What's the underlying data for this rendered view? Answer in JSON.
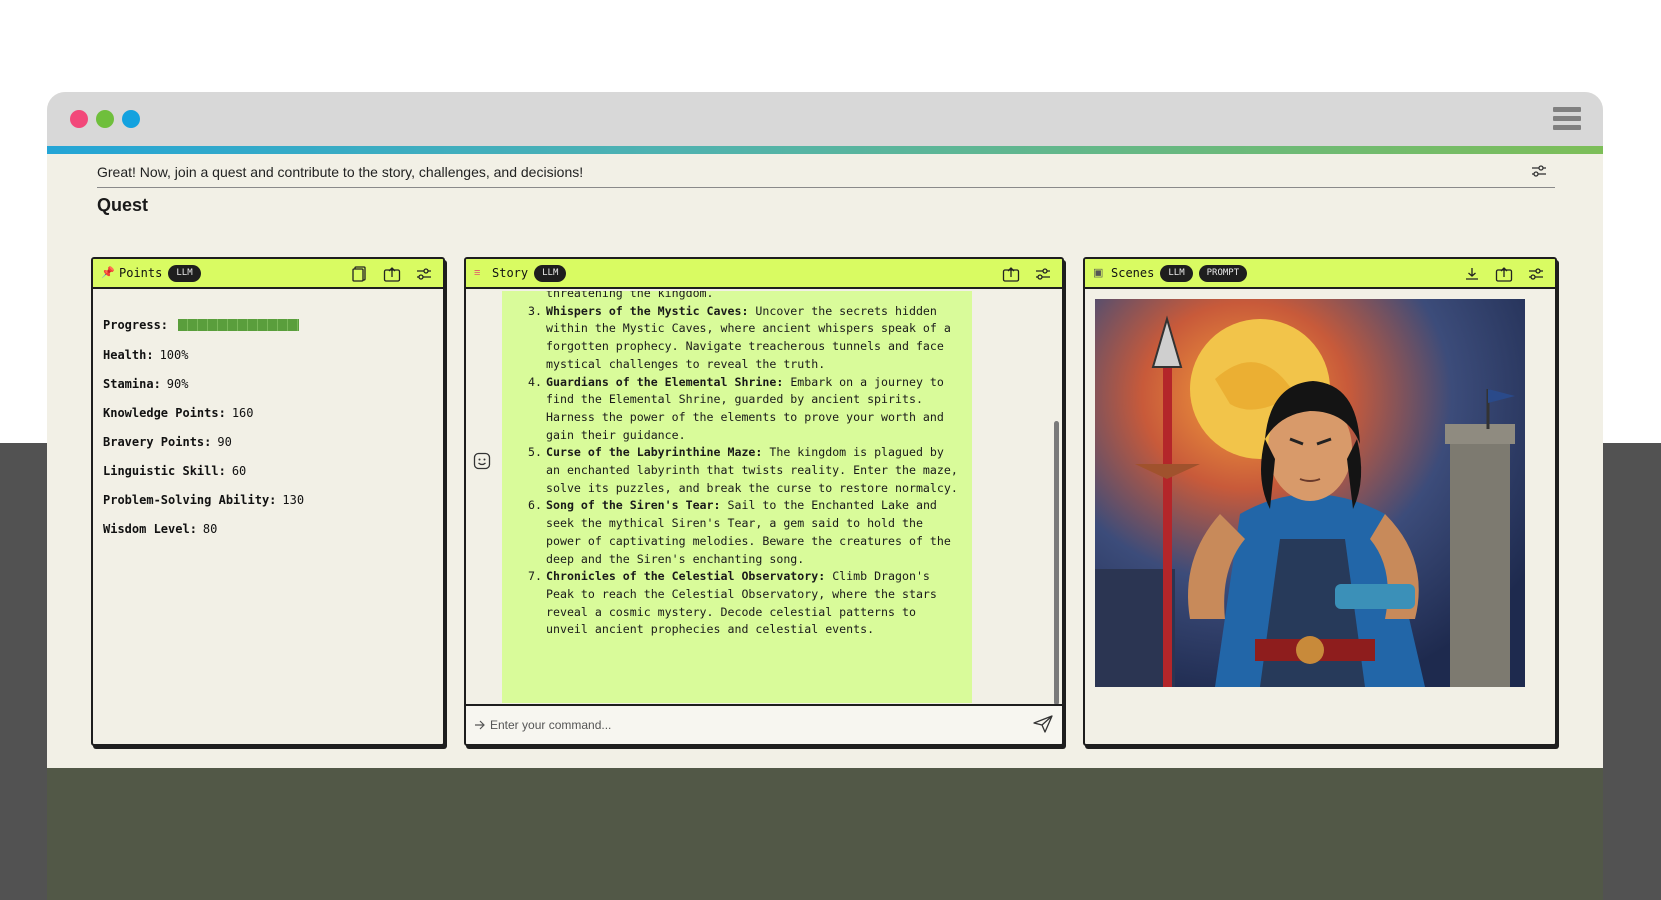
{
  "intro": {
    "text": "Great! Now, join a quest and contribute to the story, challenges, and decisions!"
  },
  "section": {
    "title": "Quest"
  },
  "colors": {
    "dot_red": "#f2487a",
    "dot_green": "#6fbf3c",
    "dot_blue": "#13a2df",
    "header_accent": "#d9fb62",
    "bubble": "#d9fb9a"
  },
  "points": {
    "title": "Points",
    "badge": "LLM",
    "icon": "pin-icon",
    "progress_label": "Progress:",
    "progress_fraction": 0.93,
    "stats": [
      {
        "label": "Health:",
        "value": "100%"
      },
      {
        "label": "Stamina:",
        "value": "90%"
      },
      {
        "label": "Knowledge Points:",
        "value": "160"
      },
      {
        "label": "Bravery Points:",
        "value": "90"
      },
      {
        "label": "Linguistic Skill:",
        "value": "60"
      },
      {
        "label": "Problem-Solving Ability:",
        "value": "130"
      },
      {
        "label": "Wisdom Level:",
        "value": "80"
      }
    ]
  },
  "story": {
    "title": "Story",
    "badge": "LLM",
    "icon": "book-icon",
    "cont_line": "threatening the kingdom.",
    "items": [
      {
        "num": "3.",
        "title": "Whispers of the Mystic Caves:",
        "text": "Uncover the secrets hidden within the Mystic Caves, where ancient whispers speak of a forgotten prophecy. Navigate treacherous tunnels and face mystical challenges to reveal the truth."
      },
      {
        "num": "4.",
        "title": "Guardians of the Elemental Shrine:",
        "text": "Embark on a journey to find the Elemental Shrine, guarded by ancient spirits. Harness the power of the elements to prove your worth and gain their guidance."
      },
      {
        "num": "5.",
        "title": "Curse of the Labyrinthine Maze:",
        "text": "The kingdom is plagued by an enchanted labyrinth that twists reality. Enter the maze, solve its puzzles, and break the curse to restore normalcy."
      },
      {
        "num": "6.",
        "title": "Song of the Siren's Tear:",
        "text": "Sail to the Enchanted Lake and seek the mythical Siren's Tear, a gem said to hold the power of captivating melodies. Beware the creatures of the deep and the Siren's enchanting song."
      },
      {
        "num": "7.",
        "title": "Chronicles of the Celestial Observatory:",
        "text": "Climb Dragon's Peak to reach the Celestial Observatory, where the stars reveal a cosmic mystery. Decode celestial patterns to unveil ancient prophecies and celestial events."
      }
    ],
    "command_placeholder": "Enter your command..."
  },
  "scenes": {
    "title": "Scenes",
    "badges": [
      "LLM",
      "PROMPT"
    ],
    "icon": "image-icon"
  }
}
